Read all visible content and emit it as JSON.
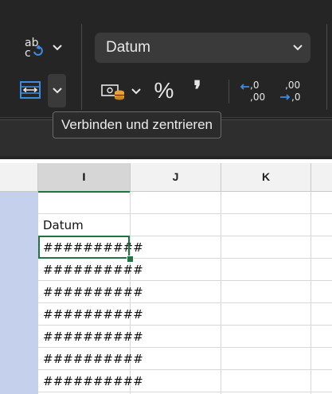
{
  "ribbon": {
    "number_format_value": "Datum",
    "percent_symbol": "%",
    "comma_symbol": "❜",
    "decrease_decimal_top": ".00",
    "decrease_decimal_bottom": "→.0",
    "increase_decimal_top": ".0",
    "increase_decimal_bottom": ",00"
  },
  "tooltip": {
    "text": "Verbinden und zentrieren"
  },
  "sheet": {
    "columns": [
      {
        "label": "I",
        "active": true
      },
      {
        "label": "J",
        "active": false
      },
      {
        "label": "K",
        "active": false
      }
    ],
    "cells": {
      "header": "Datum",
      "rows": [
        "##########",
        "##########",
        "##########",
        "##########",
        "##########",
        "##########",
        "##########"
      ]
    }
  },
  "colors": {
    "accent": "#217346",
    "ribbon_bg": "#252525",
    "sheet_bg": "#ffffff"
  }
}
